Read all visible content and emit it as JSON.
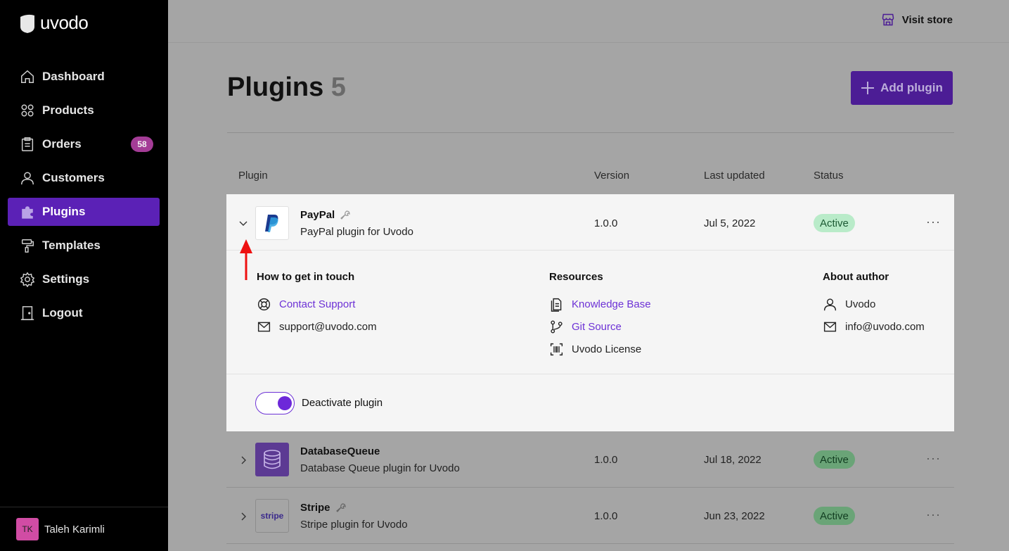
{
  "brand": {
    "name": "uvodo"
  },
  "sidebar": {
    "items": [
      {
        "label": "Dashboard",
        "icon": "home-icon"
      },
      {
        "label": "Products",
        "icon": "grid-icon"
      },
      {
        "label": "Orders",
        "icon": "clipboard-icon",
        "badge": "58"
      },
      {
        "label": "Customers",
        "icon": "user-icon"
      },
      {
        "label": "Plugins",
        "icon": "puzzle-icon",
        "active": true
      },
      {
        "label": "Templates",
        "icon": "paint-roller-icon"
      },
      {
        "label": "Settings",
        "icon": "gear-icon"
      },
      {
        "label": "Logout",
        "icon": "door-icon"
      }
    ],
    "user": {
      "initials": "TK",
      "name": "Taleh Karimli"
    }
  },
  "header": {
    "visit_store": "Visit store"
  },
  "page": {
    "title": "Plugins",
    "count": "5",
    "add_button": "Add plugin"
  },
  "table": {
    "columns": {
      "plugin": "Plugin",
      "version": "Version",
      "updated": "Last updated",
      "status": "Status"
    },
    "rows": [
      {
        "name": "PayPal",
        "description": "PayPal plugin for Uvodo",
        "version": "1.0.0",
        "updated": "Jul 5, 2022",
        "status": "Active",
        "expanded": true
      },
      {
        "name": "DatabaseQueue",
        "description": "Database Queue plugin for Uvodo",
        "version": "1.0.0",
        "updated": "Jul 18, 2022",
        "status": "Active"
      },
      {
        "name": "Stripe",
        "description": "Stripe plugin for Uvodo",
        "version": "1.0.0",
        "updated": "Jun 23, 2022",
        "status": "Active",
        "logo_text": "stripe"
      }
    ],
    "more": "···"
  },
  "details": {
    "contact": {
      "title": "How to get in touch",
      "support": "Contact Support",
      "email": "support@uvodo.com"
    },
    "resources": {
      "title": "Resources",
      "kb": "Knowledge Base",
      "git": "Git Source",
      "license": "Uvodo License"
    },
    "author": {
      "title": "About author",
      "name": "Uvodo",
      "email": "info@uvodo.com"
    },
    "deactivate": "Deactivate plugin"
  },
  "colors": {
    "accent": "#5b21b6",
    "link": "#6d32d6",
    "active_badge": "#b9ebc9",
    "sidebar_bg": "#000000",
    "overlay_bg": "#a5a5a5"
  }
}
